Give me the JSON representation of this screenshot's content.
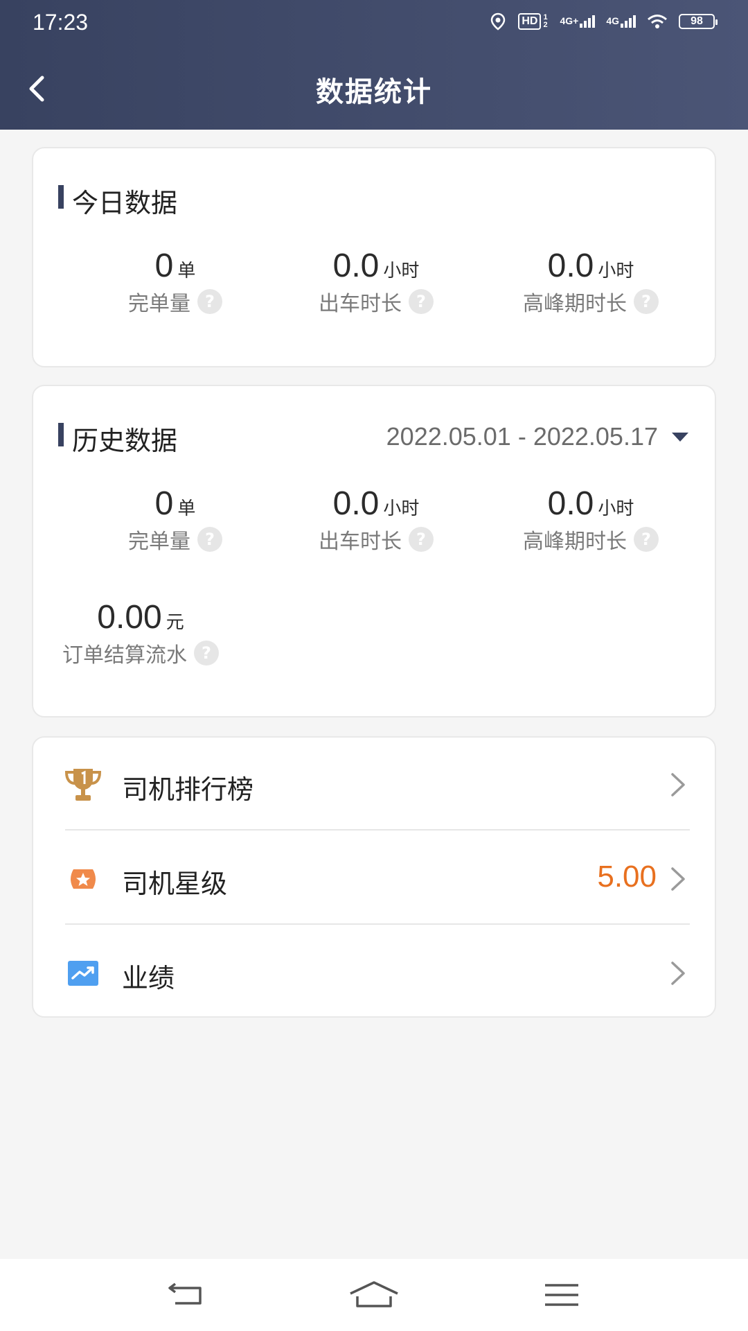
{
  "status_bar": {
    "time": "17:23",
    "hd_label": "HD",
    "hd_sub": "1 2",
    "network1": "4G+",
    "network2": "4G",
    "battery": "98"
  },
  "header": {
    "title": "数据统计"
  },
  "today": {
    "title": "今日数据",
    "metrics": [
      {
        "value": "0",
        "unit": "单",
        "label": "完单量"
      },
      {
        "value": "0.0",
        "unit": "小时",
        "label": "出车时长"
      },
      {
        "value": "0.0",
        "unit": "小时",
        "label": "高峰期时长"
      }
    ]
  },
  "history": {
    "title": "历史数据",
    "date_range": "2022.05.01 - 2022.05.17",
    "metrics": [
      {
        "value": "0",
        "unit": "单",
        "label": "完单量"
      },
      {
        "value": "0.0",
        "unit": "小时",
        "label": "出车时长"
      },
      {
        "value": "0.0",
        "unit": "小时",
        "label": "高峰期时长"
      }
    ],
    "settlement": {
      "value": "0.00",
      "unit": "元",
      "label": "订单结算流水"
    }
  },
  "help_glyph": "?",
  "menu": {
    "items": [
      {
        "label": "司机排行榜",
        "icon": "trophy-icon",
        "value": ""
      },
      {
        "label": "司机星级",
        "icon": "star-badge-icon",
        "value": "5.00"
      },
      {
        "label": "业绩",
        "icon": "trend-chart-icon",
        "value": ""
      }
    ]
  },
  "colors": {
    "header": "#384260",
    "accent_orange": "#e8701f",
    "trophy": "#c8924a",
    "star": "#f08a4b",
    "trend": "#4f9ff0"
  }
}
